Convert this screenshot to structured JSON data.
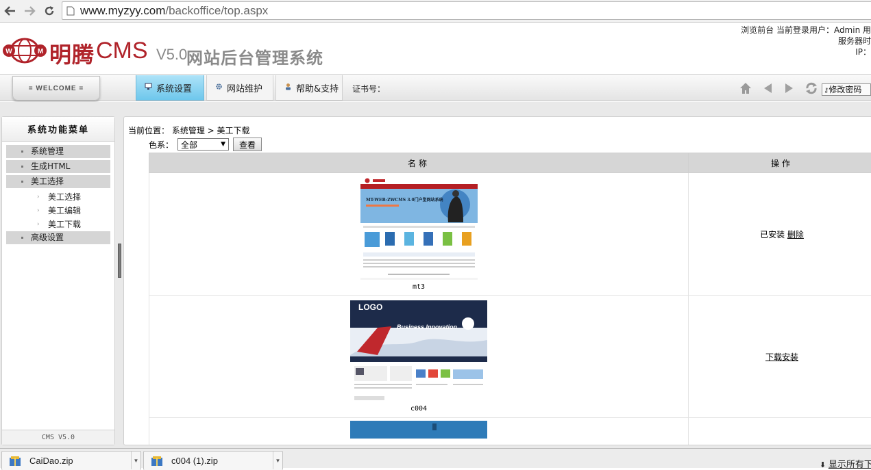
{
  "browser": {
    "url_host": "www.myzyy.com",
    "url_path": "/backoffice/top.aspx"
  },
  "header": {
    "logo_mark": "WM",
    "brand_cn": "明腾",
    "brand_cms": "CMS",
    "brand_version": "V5.0",
    "brand_subtitle": "网站后台管理系统",
    "top_line1": "浏览前台 当前登录用户：Admin 用",
    "top_line2": "服务器时",
    "top_line3": "IP："
  },
  "nav": {
    "welcome": "= WELCOME =",
    "tabs": [
      {
        "label": "系统设置",
        "icon": "monitor-icon"
      },
      {
        "label": "网站维护",
        "icon": "gear-icon"
      },
      {
        "label": "帮助&支持",
        "icon": "user-icon"
      }
    ],
    "cert_label": "证书号：",
    "change_password": "修改密码"
  },
  "sidebar": {
    "title": "系统功能菜单",
    "items": [
      {
        "label": "系统管理"
      },
      {
        "label": "生成HTML"
      },
      {
        "label": "美工选择"
      }
    ],
    "subitems": [
      {
        "label": "美工选择"
      },
      {
        "label": "美工编辑"
      },
      {
        "label": "美工下载"
      }
    ],
    "last_item": "高级设置",
    "footer": "CMS V5.0"
  },
  "main": {
    "breadcrumb_label": "当前位置：",
    "breadcrumb_path": "系统管理 > 美工下载",
    "filter_label": "色系：",
    "filter_value": "全部",
    "view_button": "查看",
    "table": {
      "col_name": "名称",
      "col_action": "操作",
      "rows": [
        {
          "name": "mt3",
          "thumb_title": "MT-WEB-ZWCMS 3.0门户型网站系统",
          "status": "已安装",
          "action": "删除"
        },
        {
          "name": "c004",
          "thumb_title": "Business Innovation",
          "thumb_logo": "LOGO",
          "status": "",
          "action": "下载安装"
        }
      ]
    }
  },
  "downloads": {
    "items": [
      {
        "filename": "CaiDao.zip"
      },
      {
        "filename": "c004 (1).zip"
      }
    ],
    "show_all": "显示所有下"
  },
  "colors": {
    "brand_red": "#b0232a",
    "active_tab": "#6ec7ec",
    "menu_item_bg": "#d5d5d5"
  }
}
